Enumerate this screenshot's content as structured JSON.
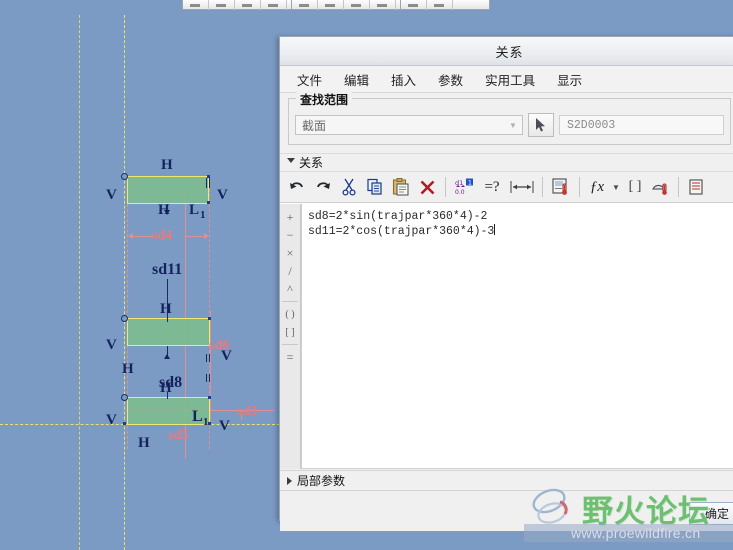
{
  "top_toolbar": {
    "icon_count": 11,
    "icon_name": "toolbar-button"
  },
  "cad": {
    "labels": [
      {
        "id": "h-top",
        "text": "H",
        "kind": "constraint"
      },
      {
        "id": "v-top-left",
        "text": "V",
        "kind": "constraint"
      },
      {
        "id": "v-top-right",
        "text": "V",
        "kind": "constraint"
      },
      {
        "id": "h-top-in",
        "text": "H",
        "kind": "constraint"
      },
      {
        "id": "l1-top",
        "text": "L",
        "kind": "constraint"
      },
      {
        "id": "l1-top-sub",
        "text": "1",
        "kind": "constraint-sub"
      },
      {
        "id": "sd4",
        "text": "sd4",
        "kind": "dimension"
      },
      {
        "id": "sd11",
        "text": "sd11",
        "kind": "dimension-selected"
      },
      {
        "id": "h-mid",
        "text": "H",
        "kind": "constraint"
      },
      {
        "id": "v-mid",
        "text": "V",
        "kind": "constraint"
      },
      {
        "id": "v-mid-right",
        "text": "V",
        "kind": "constraint"
      },
      {
        "id": "sd6",
        "text": "sd6",
        "kind": "dimension"
      },
      {
        "id": "h-mid-low",
        "text": "H",
        "kind": "constraint"
      },
      {
        "id": "sd8",
        "text": "sd8",
        "kind": "dimension-selected"
      },
      {
        "id": "h-bot-in",
        "text": "H",
        "kind": "constraint"
      },
      {
        "id": "v-bot",
        "text": "V",
        "kind": "constraint"
      },
      {
        "id": "v-bot-right",
        "text": "V",
        "kind": "constraint"
      },
      {
        "id": "l1-bot",
        "text": "L",
        "kind": "constraint"
      },
      {
        "id": "l1-bot-sub",
        "text": "1",
        "kind": "constraint-sub"
      },
      {
        "id": "sd3",
        "text": "sd3",
        "kind": "dimension"
      },
      {
        "id": "sd5",
        "text": "sd5",
        "kind": "dimension"
      },
      {
        "id": "h-bot",
        "text": "H",
        "kind": "constraint"
      }
    ],
    "colors": {
      "background": "#7c9bc4",
      "section_fill": "#7dbd8e",
      "section_edge": "#efe96e",
      "dimension_pink": "#e77b80",
      "constraint_navy": "#14235e"
    }
  },
  "dialog": {
    "title": "关系",
    "menu": [
      {
        "label": "文件"
      },
      {
        "label": "编辑"
      },
      {
        "label": "插入"
      },
      {
        "label": "参数"
      },
      {
        "label": "实用工具"
      },
      {
        "label": "显示"
      }
    ],
    "lookin": {
      "group_title": "查找范围",
      "combo_value": "截面",
      "combo_options": [
        "截面"
      ],
      "picker_icon": "cursor-arrow-icon",
      "field_value": "S2D0003"
    },
    "relations_section": {
      "header": "关系",
      "expanded": true,
      "toolbar": [
        {
          "name": "undo-icon",
          "glyph": "↶"
        },
        {
          "name": "redo-icon",
          "glyph": "↷"
        },
        {
          "name": "cut-icon",
          "glyph": "✂"
        },
        {
          "name": "copy-icon",
          "glyph": "⎘"
        },
        {
          "name": "paste-icon",
          "glyph": "📋"
        },
        {
          "name": "delete-icon",
          "glyph": "✕"
        },
        {
          "name": "dimension-toggle-icon",
          "glyph": "d1"
        },
        {
          "name": "verify-relations-icon",
          "glyph": "=?"
        },
        {
          "name": "dimension-bounds-icon",
          "glyph": "↔"
        },
        {
          "name": "unit-sensitive-icon",
          "glyph": "◳"
        },
        {
          "name": "function-icon",
          "glyph": "ƒx"
        },
        {
          "name": "function-dropdown-icon",
          "glyph": "▾"
        },
        {
          "name": "braces-icon",
          "glyph": "{ }"
        },
        {
          "name": "parameter-icon",
          "glyph": "◔"
        }
      ],
      "operators": [
        "+",
        "−",
        "×",
        "/",
        "^",
        "( )",
        "[ ]",
        "="
      ],
      "editor_lines": [
        "sd8=2*sin(trajpar*360*4)-2",
        "sd11=2*cos(trajpar*360*4)-3"
      ]
    },
    "local_params": {
      "header": "局部参数",
      "expanded": false
    },
    "ok_label": "确定"
  },
  "watermark": {
    "title": "野火论坛",
    "url": "www.proewildfire.cn",
    "logo_icon": "ring-logo-icon"
  }
}
